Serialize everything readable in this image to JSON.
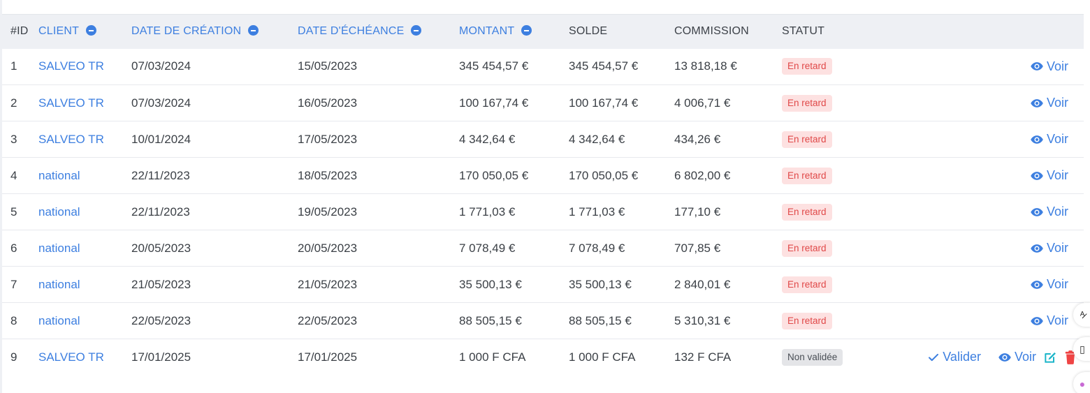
{
  "table": {
    "headers": [
      {
        "label": "#ID",
        "sortable": false
      },
      {
        "label": "CLIENT",
        "sortable": true
      },
      {
        "label": "DATE DE CRÉATION",
        "sortable": true
      },
      {
        "label": "DATE D'ÉCHÉANCE",
        "sortable": true
      },
      {
        "label": "MONTANT",
        "sortable": true
      },
      {
        "label": "SOLDE",
        "sortable": false
      },
      {
        "label": "COMMISSION",
        "sortable": false
      },
      {
        "label": "STATUT",
        "sortable": false
      },
      {
        "label": "",
        "sortable": false
      }
    ],
    "rows": [
      {
        "id": "1",
        "client": "SALVEO TR",
        "created": "07/03/2024",
        "due": "15/05/2023",
        "amount": "345 454,57 €",
        "balance": "345 454,57 €",
        "commission": "13 818,18 €",
        "status": "En retard",
        "status_type": "late"
      },
      {
        "id": "2",
        "client": "SALVEO TR",
        "created": "07/03/2024",
        "due": "16/05/2023",
        "amount": "100 167,74 €",
        "balance": "100 167,74 €",
        "commission": "4 006,71 €",
        "status": "En retard",
        "status_type": "late"
      },
      {
        "id": "3",
        "client": "SALVEO TR",
        "created": "10/01/2024",
        "due": "17/05/2023",
        "amount": "4 342,64 €",
        "balance": "4 342,64 €",
        "commission": "434,26 €",
        "status": "En retard",
        "status_type": "late"
      },
      {
        "id": "4",
        "client": "national",
        "created": "22/11/2023",
        "due": "18/05/2023",
        "amount": "170 050,05 €",
        "balance": "170 050,05 €",
        "commission": "6 802,00 €",
        "status": "En retard",
        "status_type": "late"
      },
      {
        "id": "5",
        "client": "national",
        "created": "22/11/2023",
        "due": "19/05/2023",
        "amount": "1 771,03 €",
        "balance": "1 771,03 €",
        "commission": "177,10 €",
        "status": "En retard",
        "status_type": "late"
      },
      {
        "id": "6",
        "client": "national",
        "created": "20/05/2023",
        "due": "20/05/2023",
        "amount": "7 078,49 €",
        "balance": "7 078,49 €",
        "commission": "707,85 €",
        "status": "En retard",
        "status_type": "late"
      },
      {
        "id": "7",
        "client": "national",
        "created": "21/05/2023",
        "due": "21/05/2023",
        "amount": "35 500,13 €",
        "balance": "35 500,13 €",
        "commission": "2 840,01 €",
        "status": "En retard",
        "status_type": "late"
      },
      {
        "id": "8",
        "client": "national",
        "created": "22/05/2023",
        "due": "22/05/2023",
        "amount": "88 505,15 €",
        "balance": "88 505,15 €",
        "commission": "5 310,31 €",
        "status": "En retard",
        "status_type": "late"
      },
      {
        "id": "9",
        "client": "SALVEO TR",
        "created": "17/01/2025",
        "due": "17/01/2025",
        "amount": "1 000 F CFA",
        "balance": "1 000 F CFA",
        "commission": "132 F CFA",
        "status": "Non validée",
        "status_type": "pending"
      }
    ]
  },
  "actions": {
    "view_label": "Voir",
    "validate_label": "Valider",
    "edit_icon": "edit-icon",
    "delete_icon": "trash-icon",
    "view_icon": "eye-icon",
    "validate_icon": "check-icon"
  },
  "colors": {
    "accent": "#3d7fe0",
    "late_bg": "#fde1e1",
    "late_text": "#e04848",
    "pending_bg": "#e4e5e8",
    "edit": "#1bb5c9",
    "delete": "#ef4444"
  },
  "floating_widgets": [
    {
      "icon": "translate-icon",
      "glyph": "ᴬ̷"
    },
    {
      "icon": "book-icon",
      "glyph": "▯"
    },
    {
      "icon": "assistant-icon",
      "glyph": "●"
    }
  ]
}
